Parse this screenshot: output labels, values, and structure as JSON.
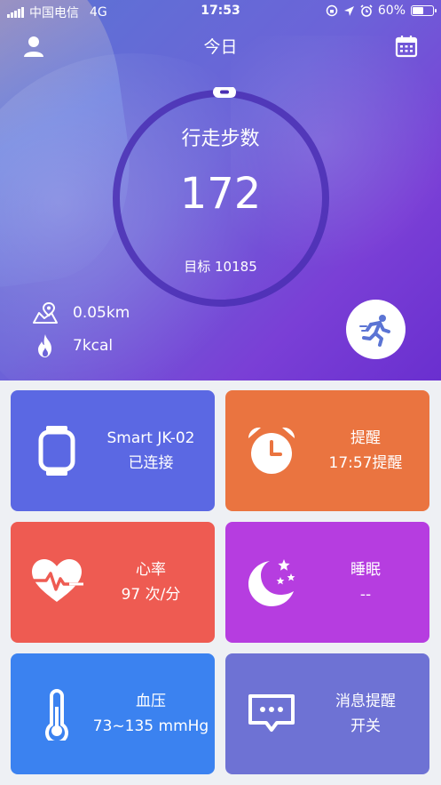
{
  "status_bar": {
    "carrier": "中国电信",
    "network": "4G",
    "time": "17:53",
    "battery": "60%",
    "battery_level": 0.6
  },
  "header": {
    "title": "今日"
  },
  "steps": {
    "label": "行走步数",
    "value": "172",
    "goal": "目标 10185",
    "progress": 0.017
  },
  "stats": {
    "distance": "0.05km",
    "calories": "7kcal"
  },
  "cards": [
    {
      "title": "Smart JK-02",
      "subtitle": "已连接",
      "icon": "watch-icon",
      "color": "#5b68e3"
    },
    {
      "title": "提醒",
      "subtitle": "17:57提醒",
      "icon": "alarm-clock-icon",
      "color": "#ea7440"
    },
    {
      "title": "心率",
      "subtitle": "97 次/分",
      "icon": "heart-rate-icon",
      "color": "#ee5b52"
    },
    {
      "title": "睡眠",
      "subtitle": "--",
      "icon": "moon-stars-icon",
      "color": "#b63de0"
    },
    {
      "title": "血压",
      "subtitle": "73~135 mmHg",
      "icon": "thermometer-icon",
      "color": "#3b82f0"
    },
    {
      "title": "消息提醒",
      "subtitle": "开关",
      "icon": "message-icon",
      "color": "#6e72d4"
    }
  ]
}
